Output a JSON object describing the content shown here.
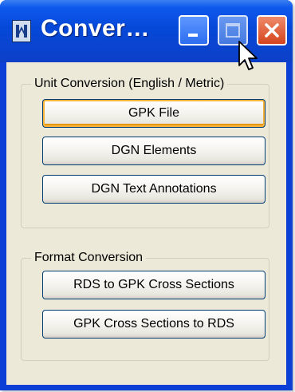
{
  "window": {
    "title": "Conver…",
    "controls": {
      "minimize": "minimize",
      "maximize": "maximize",
      "close": "close"
    }
  },
  "unit_conversion": {
    "legend": "Unit Conversion (English / Metric)",
    "buttons": [
      "GPK File",
      "DGN Elements",
      "DGN Text Annotations"
    ]
  },
  "format_conversion": {
    "legend": "Format Conversion",
    "buttons": [
      "RDS to GPK Cross Sections",
      "GPK Cross Sections to RDS"
    ]
  },
  "icons": {
    "app": "app-icon",
    "minimize": "minimize-icon",
    "maximize": "maximize-icon",
    "close": "close-icon",
    "cursor": "mouse-pointer-icon"
  },
  "colors": {
    "titlebar": "#0548d8",
    "client_bg": "#ece9d8",
    "close_button": "#d4451e",
    "hover_highlight": "#f8b33a"
  }
}
